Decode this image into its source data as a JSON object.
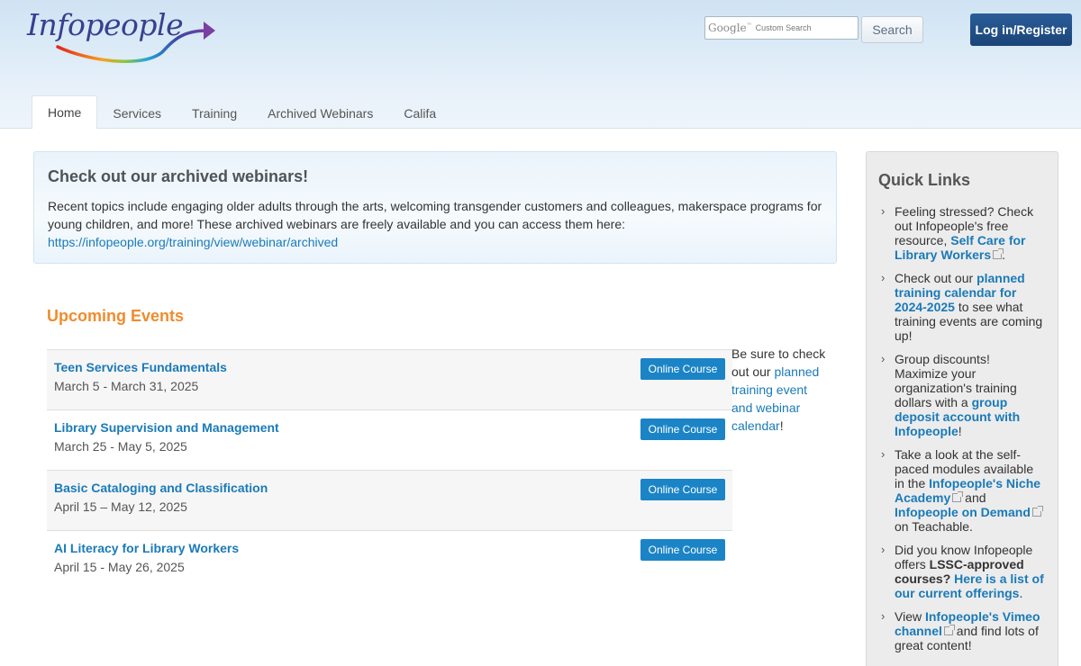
{
  "header": {
    "logo_text": "Infopeople",
    "search": {
      "google_label": "Google",
      "google_tm": "™",
      "placeholder": "Custom Search",
      "button_label": "Search"
    },
    "login_label": "Log in/Register"
  },
  "nav": {
    "tabs": [
      "Home",
      "Services",
      "Training",
      "Archived Webinars",
      "Califa"
    ],
    "active": "Home"
  },
  "notice": {
    "title": "Check out our archived webinars!",
    "body": "Recent topics include engaging older adults through the arts, welcoming transgender customers and colleagues, makerspace programs for young children, and more! These archived webinars are freely available and you can access them here: ",
    "link": "https://infopeople.org/training/view/webinar/archived"
  },
  "events": {
    "title": "Upcoming Events",
    "items": [
      {
        "title": "Teen Services Fundamentals",
        "dates": "March 5 - March 31, 2025",
        "badge": "Online Course"
      },
      {
        "title": "Library Supervision and Management",
        "dates": "March 25 - May 5, 2025",
        "badge": "Online Course"
      },
      {
        "title": "Basic Cataloging and Classification",
        "dates": "April 15 – May 12, 2025",
        "badge": "Online Course"
      },
      {
        "title": "AI Literacy for Library Workers",
        "dates": "April 15 - May 26, 2025",
        "badge": "Online Course"
      }
    ]
  },
  "side_note": {
    "before": "Be sure to check out our ",
    "link": "planned training event and webinar calendar",
    "after": "!"
  },
  "quick_links": {
    "title": "Quick Links",
    "items": [
      {
        "parts": [
          {
            "t": "Feeling stressed? Check out Infopeople's free resource, "
          },
          {
            "t": "Self Care for Library Workers",
            "link": true,
            "ext": true
          },
          {
            "t": "."
          }
        ]
      },
      {
        "parts": [
          {
            "t": "Check out our "
          },
          {
            "t": "planned training calendar for 2024-2025",
            "link": true
          },
          {
            "t": " to see what training events are coming up!"
          }
        ]
      },
      {
        "parts": [
          {
            "t": "Group discounts! Maximize your organization's training dollars with a "
          },
          {
            "t": "group deposit account with Infopeople",
            "link": true
          },
          {
            "t": "!"
          }
        ]
      },
      {
        "parts": [
          {
            "t": "Take a look at the self-paced modules available in the "
          },
          {
            "t": "Infopeople's Niche Academy",
            "link": true,
            "ext": true
          },
          {
            "t": " and "
          },
          {
            "t": "Infopeople on Demand",
            "link": true,
            "ext": true
          },
          {
            "t": " on Teachable."
          }
        ]
      },
      {
        "parts": [
          {
            "t": "Did you know Infopeople offers "
          },
          {
            "t": "LSSC-approved courses?",
            "bold": true
          },
          {
            "t": " "
          },
          {
            "t": "Here is a list of our current offerings",
            "link": true
          },
          {
            "t": "."
          }
        ]
      },
      {
        "parts": [
          {
            "t": "View "
          },
          {
            "t": "Infopeople's Vimeo channel",
            "link": true,
            "ext": true
          },
          {
            "t": " and find lots of great content!"
          }
        ]
      }
    ]
  },
  "colors": {
    "accent_orange": "#ef8c2e",
    "link_blue": "#1a7ab8",
    "login_blue": "#1f4d86",
    "badge_blue": "#1b84c6"
  }
}
